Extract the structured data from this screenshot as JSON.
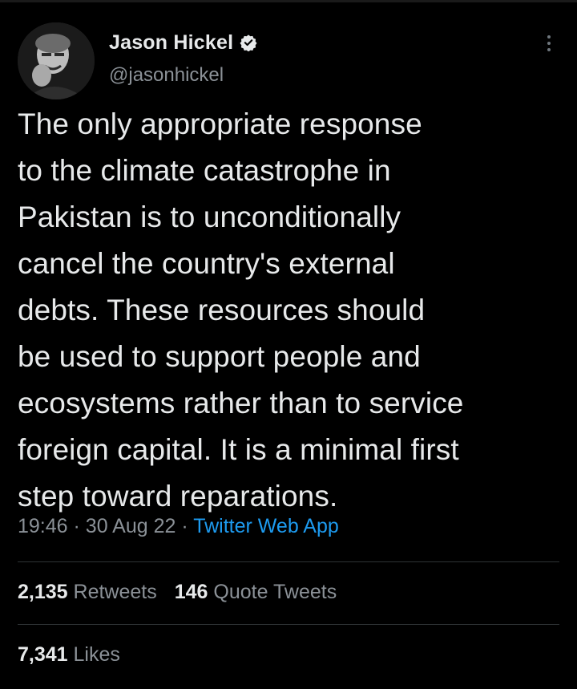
{
  "author": {
    "display_name": "Jason Hickel",
    "handle": "@jasonhickel",
    "verified": true
  },
  "tweet": {
    "text": "The only appropriate response\nto the climate catastrophe in\nPakistan is to unconditionally\ncancel the country's external\ndebts. These resources should\nbe used to support people and\necosystems rather than to service\nforeign capital. It is a minimal first\nstep toward reparations.",
    "time": "19:46",
    "separator": "·",
    "date": "30 Aug 22",
    "source": "Twitter Web App"
  },
  "stats": {
    "retweets_count": "2,135",
    "retweets_label": "Retweets",
    "quotes_count": "146",
    "quotes_label": "Quote Tweets",
    "likes_count": "7,341",
    "likes_label": "Likes"
  },
  "icons": {
    "verified": "verified-badge-icon",
    "more": "more-options-icon"
  },
  "colors": {
    "background": "#000000",
    "text": "#e7e9ea",
    "secondary": "#8b9197",
    "link": "#1d9bf0",
    "divider": "#2f3336"
  }
}
